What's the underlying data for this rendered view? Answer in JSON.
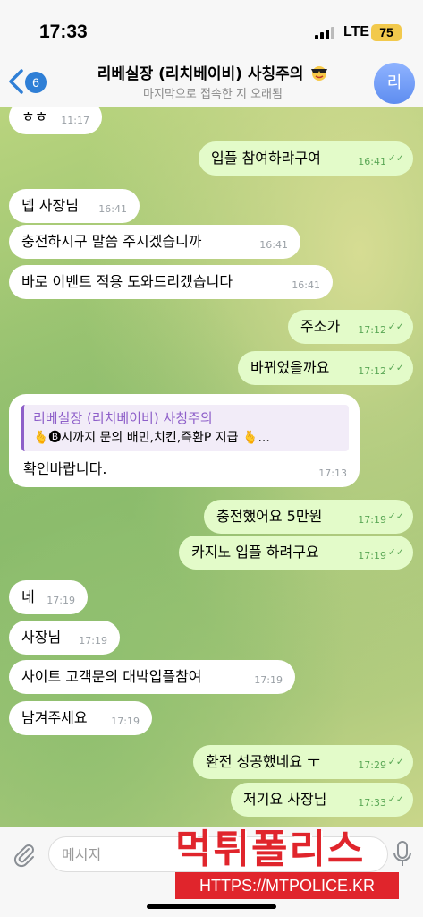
{
  "status_bar": {
    "time": "17:33",
    "network": "LTE",
    "battery": "75"
  },
  "header": {
    "back_count": "6",
    "title": "리베실장 (리치베이비) 사칭주의",
    "subtitle": "마지막으로 접속한 지 오래됨",
    "avatar_letter": "리"
  },
  "messages": [
    {
      "dir": "in",
      "text": "ㅎㅎ",
      "time": "11:17"
    },
    {
      "dir": "out",
      "text": "입플 참여하랴구여",
      "time": "16:41"
    },
    {
      "dir": "in",
      "text": "넵 사장님",
      "time": "16:41"
    },
    {
      "dir": "in",
      "text": "충전하시구  말씀 주시겠습니까",
      "time": "16:41"
    },
    {
      "dir": "in",
      "text": "바로 이벤트 적용 도와드리겠습니다",
      "time": "16:41"
    },
    {
      "dir": "out",
      "text": "주소가",
      "time": "17:12"
    },
    {
      "dir": "out",
      "text": "바뀌었을까요",
      "time": "17:12"
    },
    {
      "dir": "out",
      "text": "충전했어요 5만원",
      "time": "17:19"
    },
    {
      "dir": "out",
      "text": "카지노 입플 하려구요",
      "time": "17:19"
    },
    {
      "dir": "in",
      "text": "네",
      "time": "17:19"
    },
    {
      "dir": "in",
      "text": "사장님",
      "time": "17:19"
    },
    {
      "dir": "in",
      "text": "사이트 고객문의 대박입플참여",
      "time": "17:19"
    },
    {
      "dir": "in",
      "text": "남겨주세요",
      "time": "17:19"
    },
    {
      "dir": "out",
      "text": "환전 성공했네요 ㅜ",
      "time": "17:29"
    },
    {
      "dir": "out",
      "text": "저기요 사장님",
      "time": "17:33"
    }
  ],
  "reply_message": {
    "quote_name": "리베실장 (리치베이비) 사칭주의",
    "quote_text": "🫰🅑시까지 문의 배민,치킨,즉환P 지급 🫰...",
    "text": "확인바랍니다.",
    "time": "17:13"
  },
  "input": {
    "placeholder": "메시지"
  },
  "watermark": {
    "title": "먹튀폴리스",
    "url": "HTTPS://MTPOLICE.KR"
  },
  "colors": {
    "accent": "#2f7fd6",
    "out_bubble": "#e3fbc9",
    "watermark_red": "#e0252c"
  }
}
